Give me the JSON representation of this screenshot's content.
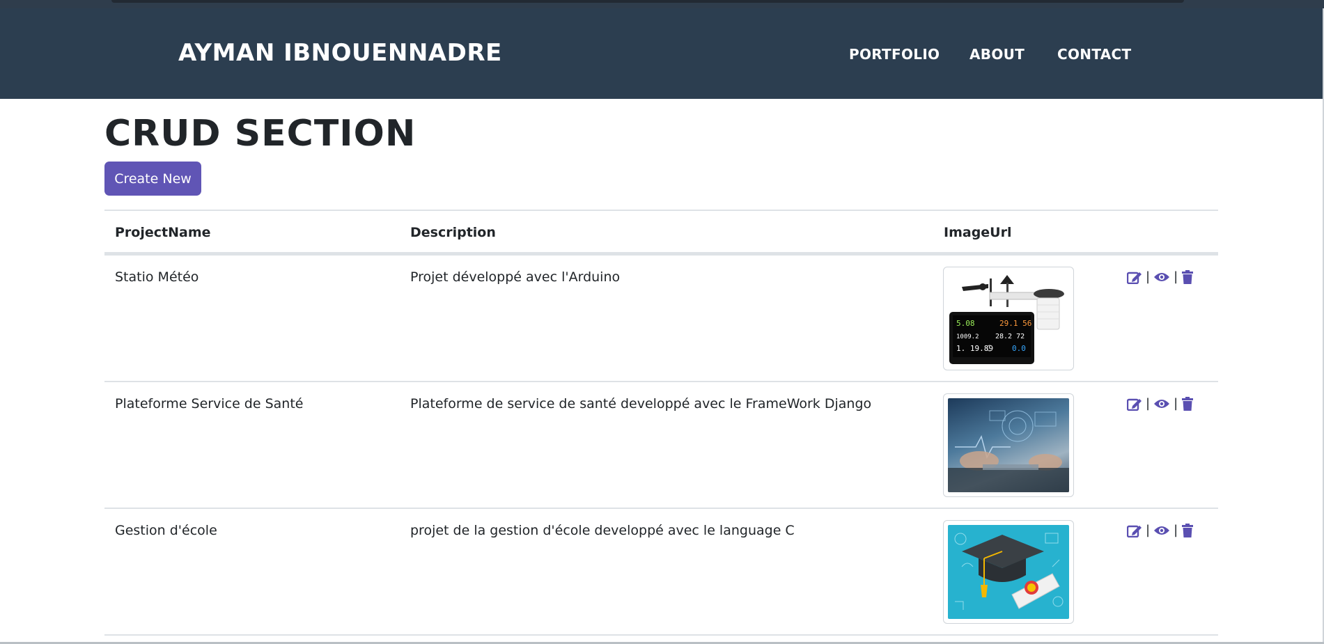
{
  "navbar": {
    "brand": "AYMAN IBNOUENNADRE",
    "links": [
      "PORTFOLIO",
      "ABOUT",
      "CONTACT"
    ]
  },
  "page": {
    "title": "CRUD SECTION",
    "create_button": "Create New"
  },
  "table": {
    "headers": [
      "ProjectName",
      "Description",
      "ImageUrl"
    ],
    "rows": [
      {
        "name": "Statio Météo",
        "description": "Projet développé avec l'Arduino",
        "image": "weather-station"
      },
      {
        "name": "Plateforme Service de Santé",
        "description": "Plateforme de service de santé developpé avec le FrameWork Django",
        "image": "health-technology"
      },
      {
        "name": "Gestion d'école",
        "description": "projet de la gestion d'école developpé avec le language C",
        "image": "graduation-cap-diploma"
      }
    ],
    "action_icons": [
      "edit-icon",
      "view-icon",
      "delete-icon"
    ]
  },
  "colors": {
    "navbar": "#2c3e50",
    "accent": "#6055b5"
  }
}
